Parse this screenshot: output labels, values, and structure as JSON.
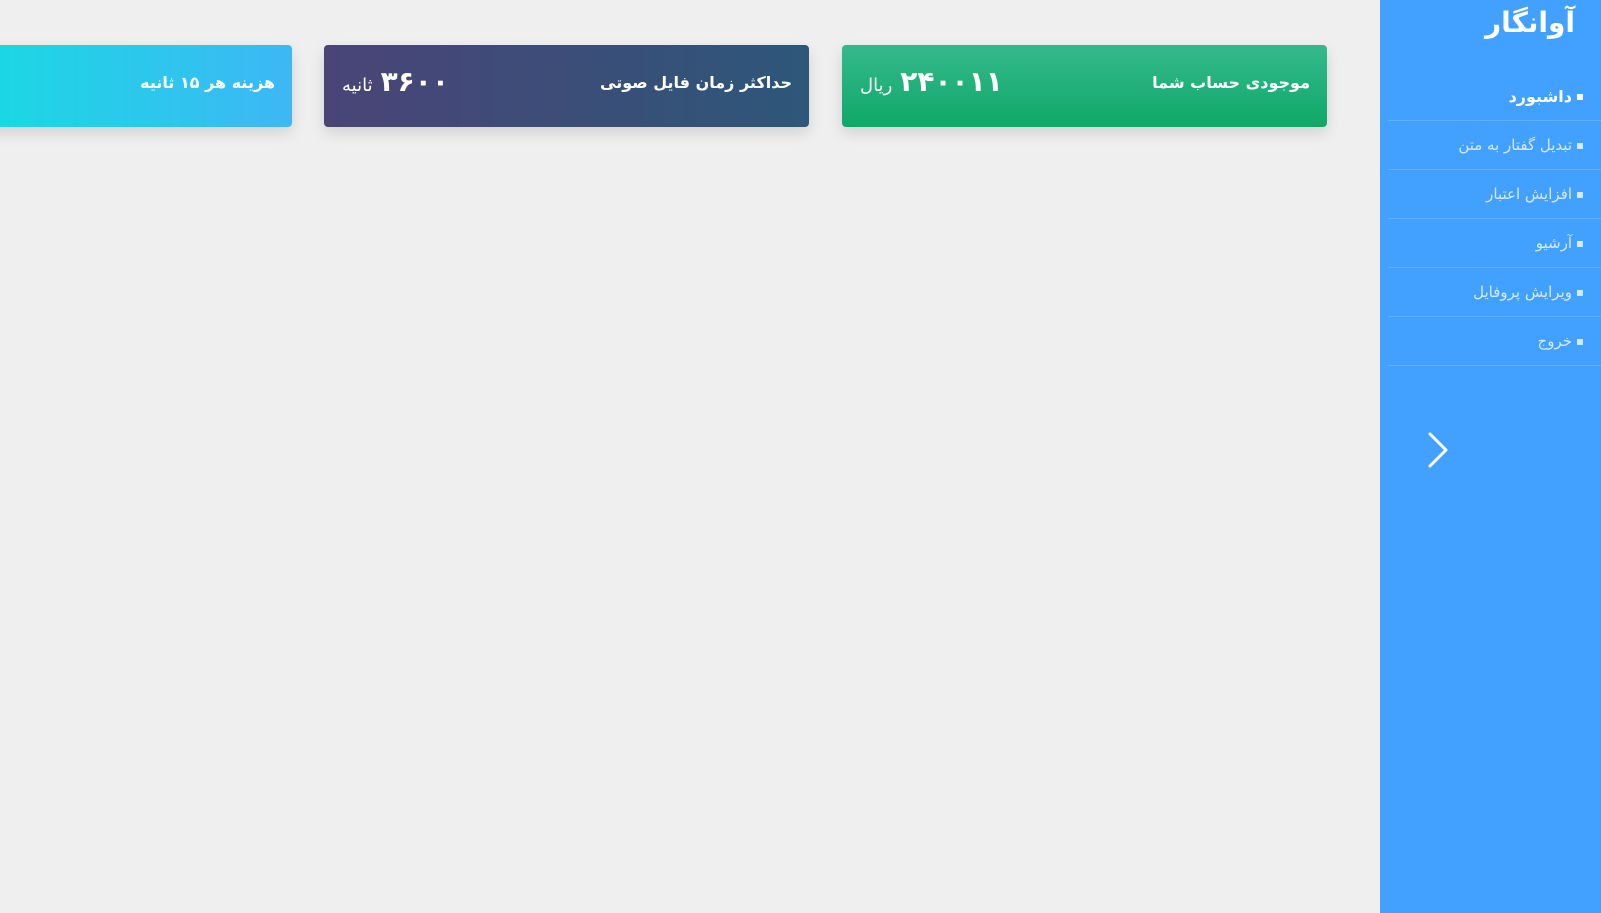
{
  "sidebar": {
    "brand": "آوانگار",
    "items": [
      {
        "label": "داشبورد",
        "icon": "dashboard-icon"
      },
      {
        "label": "تبدیل گفتار به متن",
        "icon": "speech-to-text-icon"
      },
      {
        "label": "افزایش اعتبار",
        "icon": "credit-icon"
      },
      {
        "label": "آرشیو",
        "icon": "archive-icon"
      },
      {
        "label": "ویرایش پروفایل",
        "icon": "profile-icon"
      },
      {
        "label": "خروج",
        "icon": "logout-icon"
      }
    ],
    "toggle_icon": "chevron-right-icon"
  },
  "cards": {
    "balance": {
      "label": "موجودی حساب شما",
      "value": "۲۴۰۰۱۱",
      "unit": "ریال"
    },
    "max_duration": {
      "label": "حداکثر زمان فایل صوتی",
      "value": "۳۶۰۰",
      "unit": "ثانیه"
    },
    "cost": {
      "label": "هزینه هر ۱۵ ثانیه"
    }
  },
  "colors": {
    "sidebar": "#42a0ff",
    "background": "#efefef",
    "card_green": "#0fa867",
    "card_dark": "#3b4e78",
    "card_cyan": "#1ad9e3"
  }
}
